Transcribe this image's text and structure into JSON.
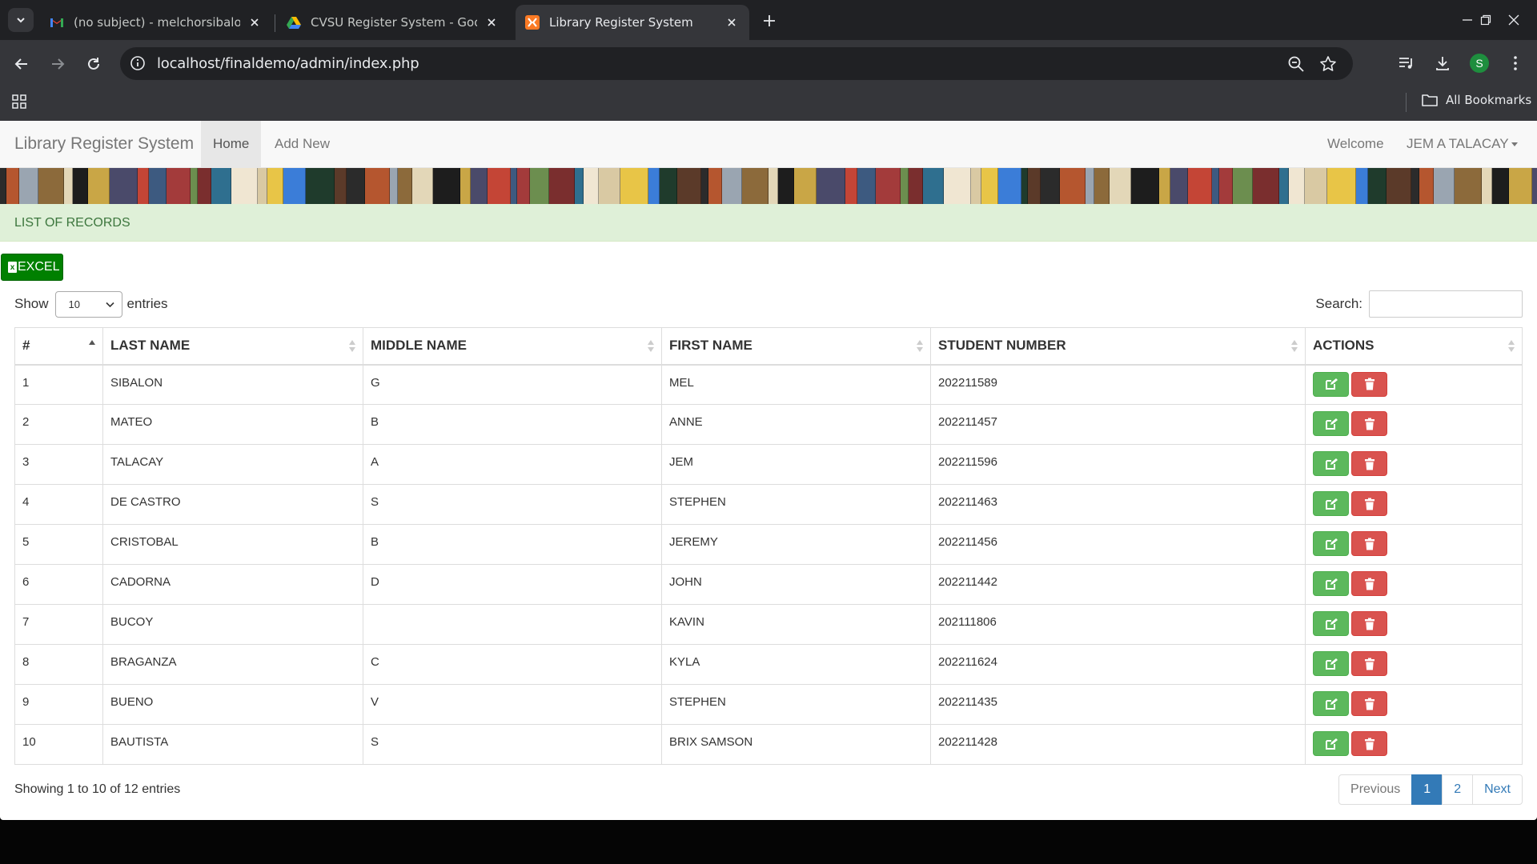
{
  "browser": {
    "tabs": [
      {
        "label": "(no subject) - melchorsibalonjr2",
        "favicon": "gmail-icon",
        "active": false
      },
      {
        "label": "CVSU Register System - Google",
        "favicon": "google-drive-icon",
        "active": false
      },
      {
        "label": "Library Register System",
        "favicon": "xampp-icon",
        "active": true
      }
    ],
    "url": "localhost/finaldemo/admin/index.php",
    "profile_initial": "S",
    "bookmarks_label": "All Bookmarks"
  },
  "navbar": {
    "brand": "Library Register System",
    "items": [
      {
        "label": "Home",
        "active": true
      },
      {
        "label": "Add New",
        "active": false
      }
    ],
    "welcome": "Welcome",
    "user": "JEM A TALACAY"
  },
  "heading": "LIST OF RECORDS",
  "excel_button": {
    "label": "EXCEL",
    "icon_letter": "x"
  },
  "length_control": {
    "show": "Show",
    "value": "10",
    "entries": "entries"
  },
  "search": {
    "label": "Search:",
    "value": ""
  },
  "table": {
    "columns": [
      "#",
      "LAST NAME",
      "MIDDLE NAME",
      "FIRST NAME",
      "STUDENT NUMBER",
      "ACTIONS"
    ],
    "sorted_column": 0,
    "rows": [
      {
        "n": "1",
        "last": "SIBALON",
        "middle": "G",
        "first": "MEL",
        "student_number": "202211589"
      },
      {
        "n": "2",
        "last": "MATEO",
        "middle": "B",
        "first": "ANNE",
        "student_number": "202211457"
      },
      {
        "n": "3",
        "last": "TALACAY",
        "middle": "A",
        "first": "JEM",
        "student_number": "202211596"
      },
      {
        "n": "4",
        "last": "DE CASTRO",
        "middle": "S",
        "first": "STEPHEN",
        "student_number": "202211463"
      },
      {
        "n": "5",
        "last": "CRISTOBAL",
        "middle": "B",
        "first": "JEREMY",
        "student_number": "202211456"
      },
      {
        "n": "6",
        "last": "CADORNA",
        "middle": "D",
        "first": "JOHN",
        "student_number": "202211442"
      },
      {
        "n": "7",
        "last": "BUCOY",
        "middle": "",
        "first": "KAVIN",
        "student_number": "202111806"
      },
      {
        "n": "8",
        "last": "BRAGANZA",
        "middle": "C",
        "first": "KYLA",
        "student_number": "202211624"
      },
      {
        "n": "9",
        "last": "BUENO",
        "middle": "V",
        "first": "STEPHEN",
        "student_number": "202211435"
      },
      {
        "n": "10",
        "last": "BAUTISTA",
        "middle": "S",
        "first": "BRIX SAMSON",
        "student_number": "202211428"
      }
    ]
  },
  "info": "Showing 1 to 10 of 12 entries",
  "pagination": {
    "previous": "Previous",
    "pages": [
      "1",
      "2"
    ],
    "current": "1",
    "next": "Next"
  },
  "colors": {
    "edit_button": "#5cb85c",
    "delete_button": "#d9534f",
    "excel_button": "#008000",
    "heading_bg": "#dff0d8",
    "heading_text": "#3c763d",
    "pager_active": "#337ab7"
  }
}
